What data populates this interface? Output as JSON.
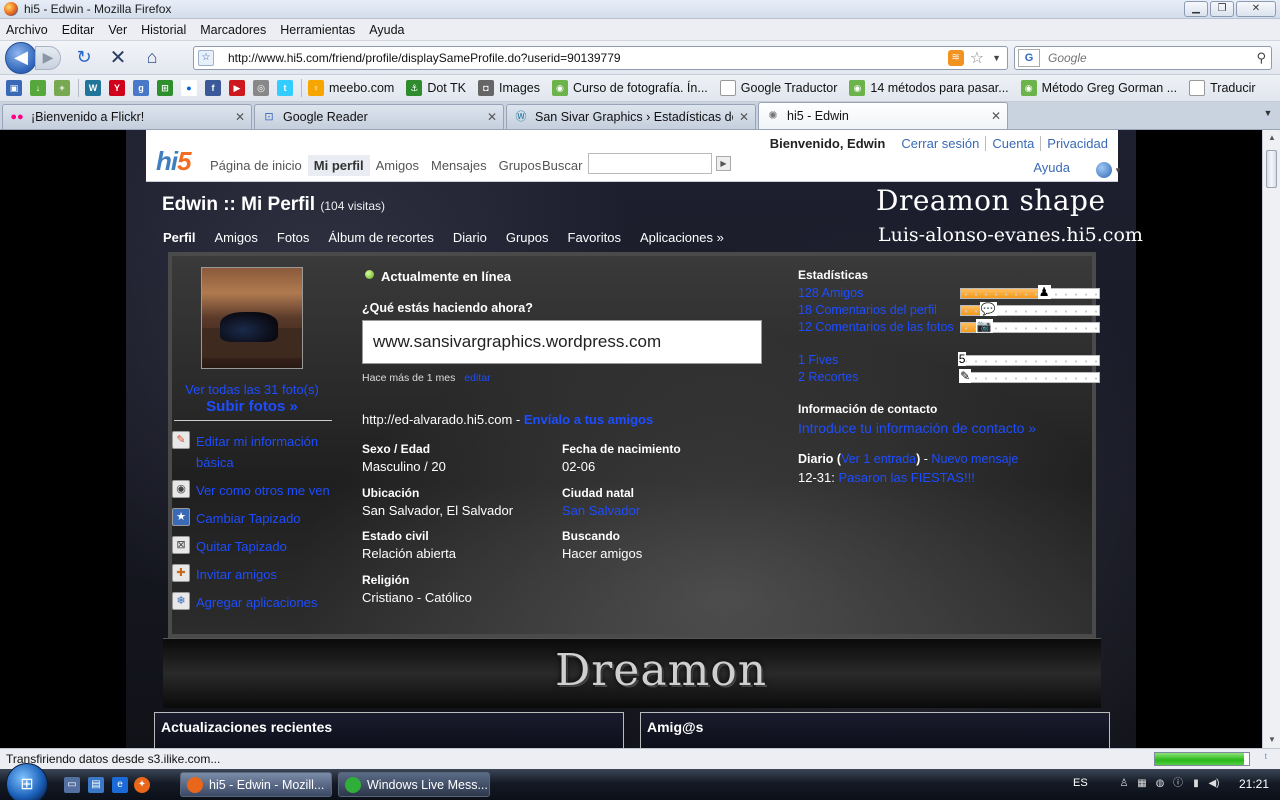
{
  "window": {
    "title": "hi5 - Edwin - Mozilla Firefox"
  },
  "menu": [
    "Archivo",
    "Editar",
    "Ver",
    "Historial",
    "Marcadores",
    "Herramientas",
    "Ayuda"
  ],
  "navbar": {
    "url": "http://www.hi5.com/friend/profile/displaySameProfile.do?userid=90139779",
    "search_placeholder": "Google"
  },
  "bookmarks": [
    {
      "label": "meebo.com",
      "icon": "meebo-icon",
      "color": "#f7a600"
    },
    {
      "label": "Dot TK",
      "icon": "dottk-icon",
      "color": "#2e8b2e"
    },
    {
      "label": "Images",
      "icon": "camera-icon",
      "color": "#666666"
    },
    {
      "label": "Curso de fotografía. Ín...",
      "icon": "bookmark-icon",
      "color": "#6bb34a"
    },
    {
      "label": "Google Traductor",
      "icon": "page-icon",
      "color": "#ffffff"
    },
    {
      "label": "14 métodos para pasar...",
      "icon": "bookmark-icon",
      "color": "#6bb34a"
    },
    {
      "label": "Método Greg Gorman ...",
      "icon": "bookmark-icon",
      "color": "#6bb34a"
    },
    {
      "label": "Traducir",
      "icon": "page-icon",
      "color": "#ffffff"
    }
  ],
  "tabs": [
    {
      "label": "¡Bienvenido a Flickr!",
      "icon": "flickr-icon",
      "active": false
    },
    {
      "label": "Google Reader",
      "icon": "reader-icon",
      "active": false
    },
    {
      "label": "San Sivar Graphics › Estadísticas del ...",
      "icon": "wordpress-icon",
      "active": false
    },
    {
      "label": "hi5 - Edwin",
      "icon": "loading-icon",
      "active": true
    }
  ],
  "hi5": {
    "logo": "hi5",
    "nav": [
      "Página de inicio",
      "Mi perfil",
      "Amigos",
      "Mensajes",
      "Grupos"
    ],
    "search_label": "Buscar",
    "welcome": "Bienvenido, Edwin",
    "links": [
      "Cerrar sesión",
      "Cuenta",
      "Privacidad"
    ],
    "help": "Ayuda"
  },
  "profile": {
    "title": "Edwin :: Mi Perfil",
    "visits": "(104 visitas)",
    "banner_line1": "Dreamon shape",
    "banner_line2": "Luis-alonso-evanes.hi5.com",
    "subnav": [
      "Perfil",
      "Amigos",
      "Fotos",
      "Álbum de recortes",
      "Diario",
      "Grupos",
      "Favoritos",
      "Aplicaciones »"
    ],
    "see_photos": "Ver todas las 31 foto(s)",
    "upload_photos": "Subir fotos »",
    "actions": [
      {
        "label": "Editar mi información básica",
        "icon": "edit-icon"
      },
      {
        "label": "Ver como otros me ven",
        "icon": "eye-icon"
      },
      {
        "label": "Cambiar Tapizado",
        "icon": "star-icon"
      },
      {
        "label": "Quitar Tapizado",
        "icon": "remove-icon"
      },
      {
        "label": "Invitar amigos",
        "icon": "invite-icon"
      },
      {
        "label": "Agregar aplicaciones",
        "icon": "apps-icon"
      }
    ],
    "online": "Actualmente en línea",
    "doing_label": "¿Qué estás haciendo ahora?",
    "status": "www.sansivargraphics.wordpress.com",
    "status_time": "Hace más de 1 mes",
    "status_edit": "editar",
    "profile_url": "http://ed-alvarado.hi5.com",
    "send_link": "Envíalo a tus amigos",
    "fields": {
      "sex_age_label": "Sexo /  Edad",
      "sex_age_value": "Masculino /  20",
      "birth_label": "Fecha de nacimiento",
      "birth_value": "02-06",
      "location_label": "Ubicación",
      "location_value": "San Salvador, El Salvador",
      "hometown_label": "Ciudad natal",
      "hometown_value": "San Salvador",
      "civil_label": "Estado civil",
      "civil_value": "Relación abierta",
      "seeking_label": "Buscando",
      "seeking_value": "Hacer amigos",
      "religion_label": "Religión",
      "religion_value": "Cristiano - Católico"
    },
    "stats_title": "Estadísticas",
    "stats": [
      {
        "label": "128 Amigos",
        "fill": 0.6,
        "marker": "♟"
      },
      {
        "label": "18 Comentarios del perfil",
        "fill": 0.18,
        "marker": "💬"
      },
      {
        "label": "12 Comentarios de las fotos",
        "fill": 0.15,
        "marker": "📷"
      },
      {
        "label": "1 Fives",
        "fill": 0.02,
        "marker": "5"
      },
      {
        "label": "2 Recortes",
        "fill": 0.03,
        "marker": "✎"
      }
    ],
    "contact_title": "Información de contacto",
    "contact_link": "Introduce tu información de contacto »",
    "diary_label": "Diario",
    "diary_entries_link": "Ver 1 entrada",
    "diary_new_link": "Nuevo mensaje",
    "diary_date": "12-31:",
    "diary_entry": "Pasaron las FIESTAS!!!",
    "footer_banner": "Dreamon",
    "box_updates": "Actualizaciones recientes",
    "box_friends": "Amig@s"
  },
  "statusbar": {
    "text": "Transfiriendo datos desde s3.ilike.com...",
    "progress": 0.95
  },
  "taskbar": {
    "tasks": [
      "hi5 - Edwin - Mozill...",
      "Windows Live Mess..."
    ],
    "lang": "ES",
    "clock": "21:21"
  }
}
